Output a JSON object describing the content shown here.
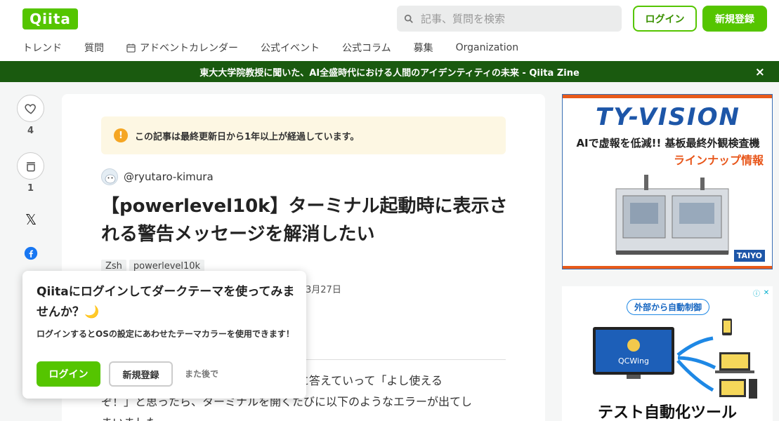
{
  "header": {
    "logo": "Qiita",
    "search_placeholder": "記事、質問を検索",
    "login_label": "ログイン",
    "signup_label": "新規登録",
    "nav": [
      "トレンド",
      "質問",
      "アドベントカレンダー",
      "公式イベント",
      "公式コラム",
      "募集",
      "Organization"
    ]
  },
  "banner": {
    "text": "東大大学院教授に聞いた、AI全盛時代における人間のアイデンティティの未来 - Qiita Zine",
    "close": "×"
  },
  "side": {
    "like_count": "4",
    "stock_count": "1",
    "x_label": "𝕏"
  },
  "article": {
    "notice_icon": "!",
    "notice": "この記事は最終更新日から1年以上が経過しています。",
    "author": "@ryutaro-kimura",
    "title": "【powerlevel10k】ターミナル起動時に表示される警告メッセージを解消したい",
    "tags": [
      "Zsh",
      "powerlevel10k"
    ],
    "date": "3月27日",
    "body_line1": "noに答えていって「よし使える",
    "body_line2": "ぞ！」と思ったら、ターミナルを開くたびに以下のようなエラーが出てし",
    "body_line3": "まいました"
  },
  "ads": {
    "ad1_logo": "TY-VISION",
    "ad1_line1": "AIで虚報を低減!! 基板最終外観検査機",
    "ad1_line2": "ラインナップ情報",
    "ad1_brand": "TAIYO",
    "ad2_tag": "外部から自動制御",
    "ad2_screen": "QCWing",
    "ad2_caption": "テスト自動化ツール"
  },
  "popup": {
    "title": "Qiitaにログインしてダークテーマを使ってみませんか？🌙",
    "desc": "ログインするとOSの設定にあわせたテーマカラーを使用できます！",
    "login_label": "ログイン",
    "signup_label": "新規登録",
    "later_label": "また後で"
  },
  "colors": {
    "brand": "#55c500",
    "banner": "#1a5a0f",
    "notice_bg": "#fdf7e3"
  }
}
